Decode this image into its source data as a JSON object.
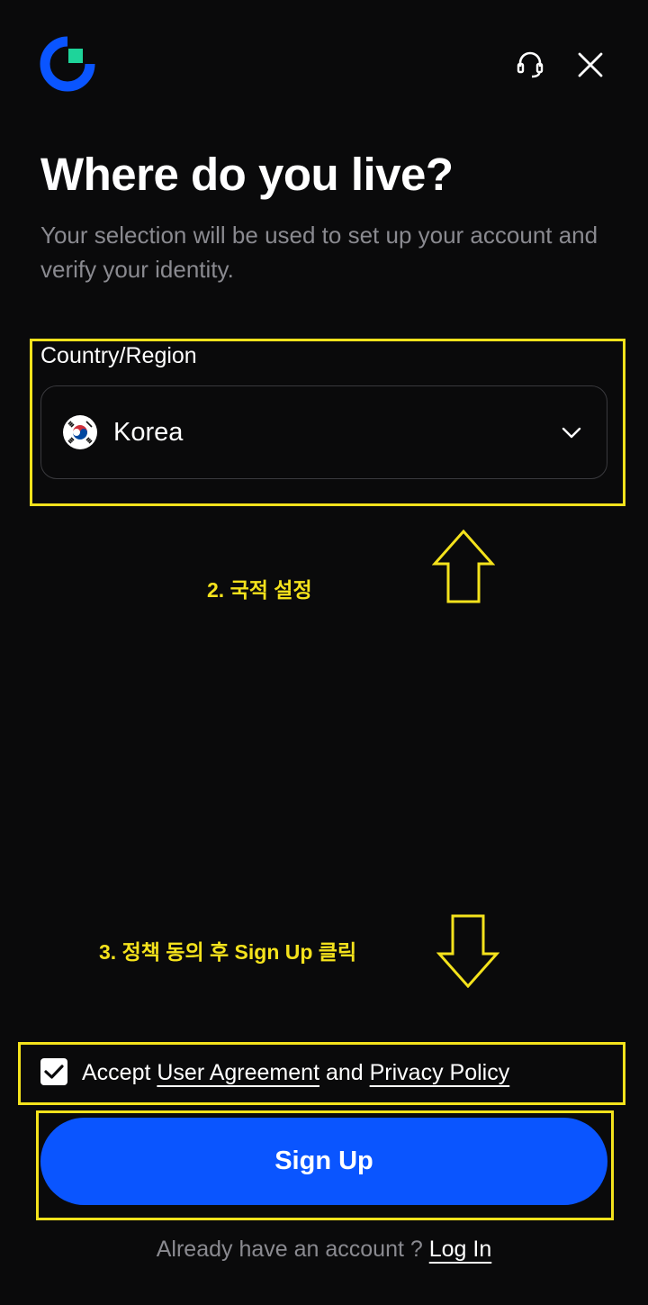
{
  "header": {
    "logo_icon": "brand-logo-icon",
    "support_icon": "headset-icon",
    "close_icon": "close-icon",
    "brand_color": "#0a55ff",
    "brand_accent": "#1ed49a"
  },
  "main": {
    "title": "Where do you live?",
    "subtitle": "Your selection will be used to set up your account and verify your identity.",
    "country_field": {
      "label": "Country/Region",
      "value": "Korea",
      "flag_icon": "south-korea-flag-icon",
      "dropdown_icon": "chevron-down-icon"
    }
  },
  "annotations": {
    "step2": "2. 국적 설정",
    "step3": "3. 정책 동의 후 Sign Up 클릭",
    "color": "#f4e21c"
  },
  "agreement": {
    "checked": true,
    "prefix": "Accept ",
    "user_agreement": "User Agreement",
    "middle": " and ",
    "privacy_policy": "Privacy Policy"
  },
  "actions": {
    "signup_label": "Sign Up",
    "login_prompt": "Already have an account ? ",
    "login_label": "Log In"
  }
}
